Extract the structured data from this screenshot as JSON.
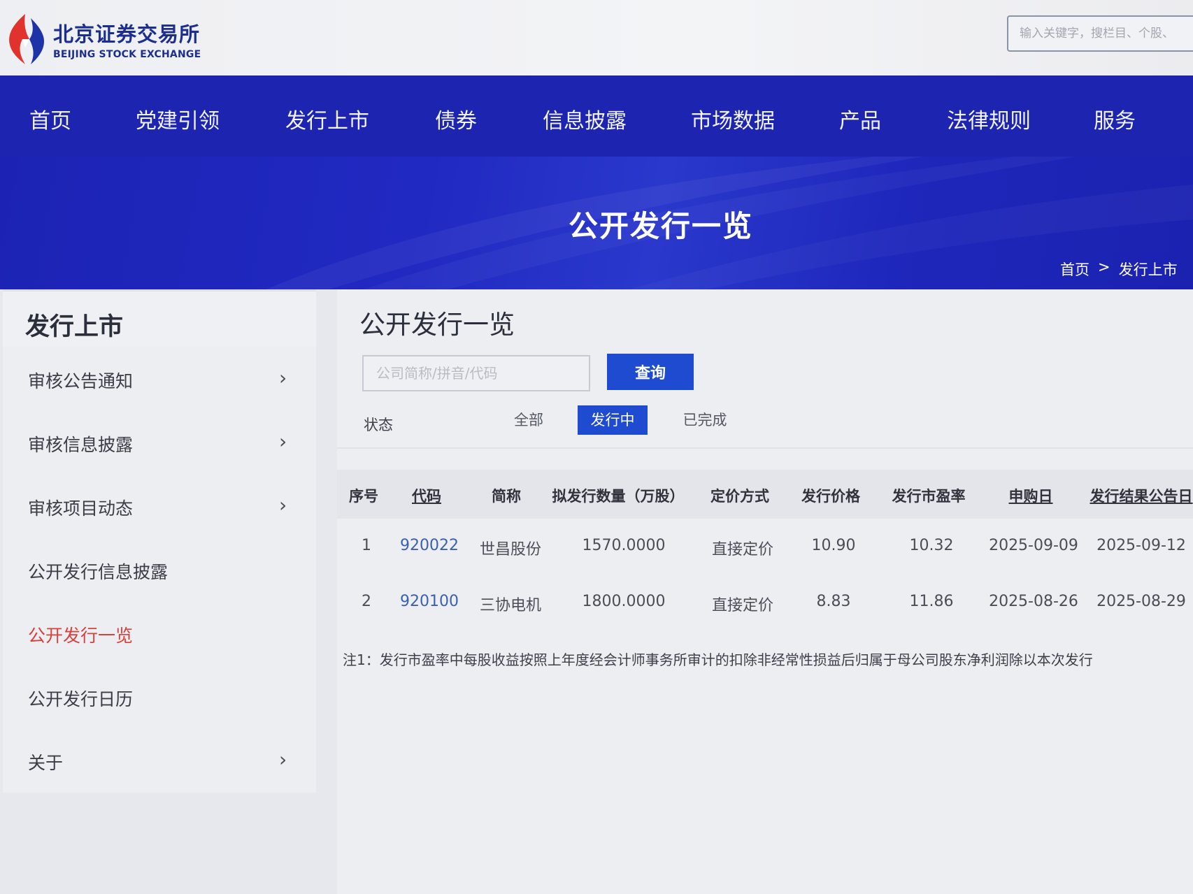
{
  "header": {
    "logo_cn": "北京证券交易所",
    "logo_en": "BEIJING STOCK EXCHANGE",
    "search_placeholder": "输入关键字，搜栏目、个股、"
  },
  "nav": {
    "items": [
      "首页",
      "党建引领",
      "发行上市",
      "债券",
      "信息披露",
      "市场数据",
      "产品",
      "法律规则",
      "服务"
    ]
  },
  "banner": {
    "title": "公开发行一览",
    "breadcrumb": [
      "首页",
      ">",
      "发行上市"
    ]
  },
  "sidebar": {
    "title": "发行上市",
    "items": [
      {
        "label": "审核公告通知",
        "chevron": "›"
      },
      {
        "label": "审核信息披露",
        "chevron": "›"
      },
      {
        "label": "审核项目动态",
        "chevron": "›"
      },
      {
        "label": "公开发行信息披露",
        "chevron": ""
      },
      {
        "label": "公开发行一览",
        "chevron": ""
      },
      {
        "label": "公开发行日历",
        "chevron": ""
      },
      {
        "label": "关于",
        "chevron": "›"
      }
    ],
    "active_index": 4
  },
  "main": {
    "title": "公开发行一览",
    "search_placeholder": "公司简称/拼音/代码",
    "query_label": "查询",
    "status": {
      "label": "状态",
      "options": [
        "全部",
        "发行中",
        "已完成"
      ],
      "selected": "发行中"
    },
    "table": {
      "headers": [
        "序号",
        "代码",
        "简称",
        "拟发行数量（万股）",
        "定价方式",
        "发行价格",
        "发行市盈率",
        "申购日",
        "发行结果公告日"
      ],
      "rows": [
        [
          "1",
          "920022",
          "世昌股份",
          "1570.0000",
          "直接定价",
          "10.90",
          "10.32",
          "2025-09-09",
          "2025-09-12"
        ],
        [
          "2",
          "920100",
          "三协电机",
          "1800.0000",
          "直接定价",
          "8.83",
          "11.86",
          "2025-08-26",
          "2025-08-29"
        ]
      ]
    },
    "note": "注1：发行市盈率中每股收益按照上年度经会计师事务所审计的扣除非经常性损益后归属于母公司股东净利润除以本次发行"
  },
  "colors": {
    "nav_blue": "#1d25b0",
    "accent_blue": "#1f4bd1",
    "active_red": "#d8413b",
    "code_link": "#3b5fb3"
  }
}
